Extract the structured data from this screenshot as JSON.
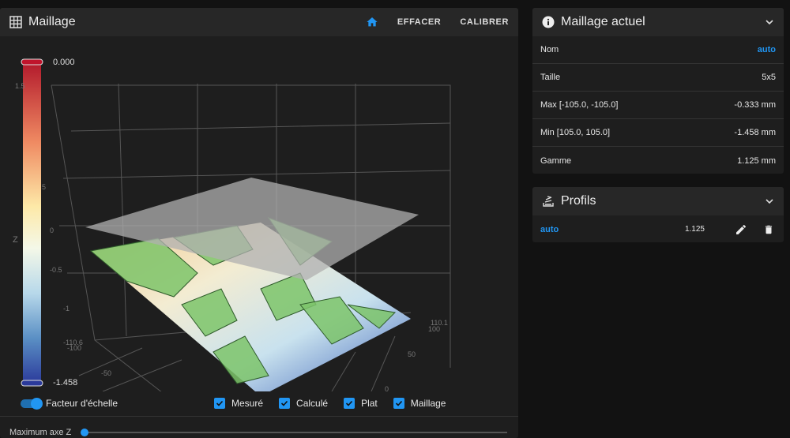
{
  "mesh_card": {
    "title": "Maillage",
    "icon": "grid-icon",
    "home_icon": "home-icon",
    "clear_label": "EFFACER",
    "calibrate_label": "CALIBRER"
  },
  "colorbar": {
    "max_label": "0.000",
    "min_label": "-1.458",
    "colors": [
      "#b2182b",
      "#ef8a62",
      "#fddbc7",
      "#f7f7f7",
      "#d1e5f0",
      "#67a9cf",
      "#2b3a9b"
    ]
  },
  "plot": {
    "z_axis_label": "Z",
    "z_ticks": [
      "1.5",
      "5",
      "0",
      "-0.5",
      "-1"
    ],
    "x_ticks": [
      "-110.6",
      "-100",
      "-50"
    ],
    "y_ticks": [
      "110.1",
      "100",
      "50",
      "0"
    ],
    "flat_color": "#b0b0b0",
    "mesh_color": "#7cc46a"
  },
  "controls": {
    "scale_toggle_label": "Facteur d'échelle",
    "scale_toggle_on": true,
    "checkboxes": [
      {
        "label": "Mesuré",
        "checked": true
      },
      {
        "label": "Calculé",
        "checked": true
      },
      {
        "label": "Plat",
        "checked": true
      },
      {
        "label": "Maillage",
        "checked": true
      }
    ],
    "zmax_label": "Maximum axe Z",
    "zmax_value": 0
  },
  "current_mesh": {
    "title": "Maillage actuel",
    "icon": "info-icon",
    "rows": [
      {
        "label": "Nom",
        "value": "auto"
      },
      {
        "label": "Taille",
        "value": "5x5"
      },
      {
        "label": "Max [-105.0, -105.0]",
        "value": "-0.333 mm"
      },
      {
        "label": "Min [105.0, 105.0]",
        "value": "-1.458 mm"
      },
      {
        "label": "Gamme",
        "value": "1.125 mm"
      }
    ]
  },
  "profiles": {
    "title": "Profils",
    "icon": "layers-icon",
    "items": [
      {
        "name": "auto",
        "range": "1.125"
      }
    ]
  },
  "accent": "#2196f3"
}
